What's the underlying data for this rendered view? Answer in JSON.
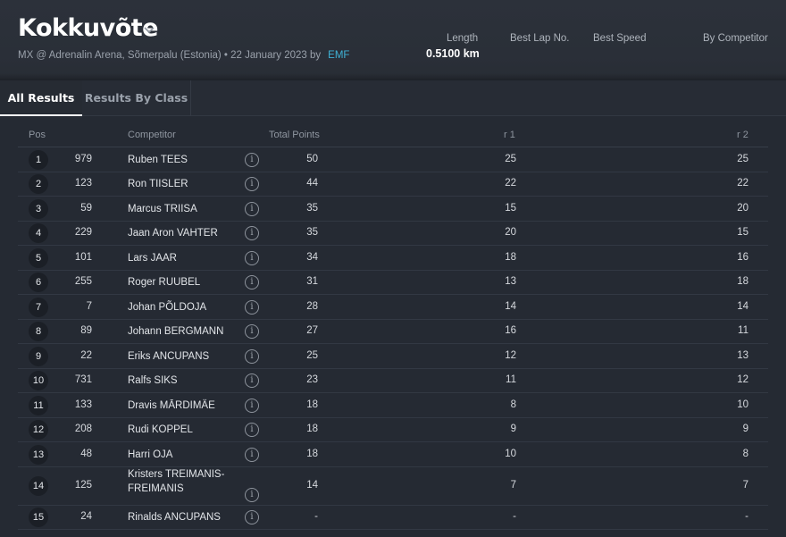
{
  "event": {
    "title": "Kokkuvõte",
    "subtitle": "MX @ Adrenalin Arena, Sõmerpalu (Estonia) • 22 January 2023 by",
    "organizer": "EMF"
  },
  "stats": {
    "length_label": "Length",
    "length_value": "0.5100 km",
    "best_lap_label": "Best Lap No.",
    "best_speed_label": "Best Speed",
    "by_competitor_label": "By Competitor"
  },
  "tabs": [
    {
      "label": "All Results",
      "active": true
    },
    {
      "label": "Results By Class",
      "active": false
    }
  ],
  "table": {
    "headers": {
      "pos": "Pos",
      "competitor": "Competitor",
      "total_points": "Total Points",
      "r1": "r 1",
      "r2": "r 2"
    },
    "rows": [
      {
        "pos": "1",
        "number": "979",
        "name": "Ruben TEES",
        "total": "50",
        "r1": "25",
        "r2": "25"
      },
      {
        "pos": "2",
        "number": "123",
        "name": "Ron TIISLER",
        "total": "44",
        "r1": "22",
        "r2": "22"
      },
      {
        "pos": "3",
        "number": "59",
        "name": "Marcus TRIISA",
        "total": "35",
        "r1": "15",
        "r2": "20"
      },
      {
        "pos": "4",
        "number": "229",
        "name": "Jaan Aron VAHTER",
        "total": "35",
        "r1": "20",
        "r2": "15"
      },
      {
        "pos": "5",
        "number": "101",
        "name": "Lars JAAR",
        "total": "34",
        "r1": "18",
        "r2": "16"
      },
      {
        "pos": "6",
        "number": "255",
        "name": "Roger RUUBEL",
        "total": "31",
        "r1": "13",
        "r2": "18"
      },
      {
        "pos": "7",
        "number": "7",
        "name": "Johan PÕLDOJA",
        "total": "28",
        "r1": "14",
        "r2": "14"
      },
      {
        "pos": "8",
        "number": "89",
        "name": "Johann BERGMANN",
        "total": "27",
        "r1": "16",
        "r2": "11"
      },
      {
        "pos": "9",
        "number": "22",
        "name": "Eriks ANCUPANS",
        "total": "25",
        "r1": "12",
        "r2": "13"
      },
      {
        "pos": "10",
        "number": "731",
        "name": "Ralfs SIKS",
        "total": "23",
        "r1": "11",
        "r2": "12"
      },
      {
        "pos": "11",
        "number": "133",
        "name": "Dravis MĀRDIMÄE",
        "total": "18",
        "r1": "8",
        "r2": "10"
      },
      {
        "pos": "12",
        "number": "208",
        "name": "Rudi KOPPEL",
        "total": "18",
        "r1": "9",
        "r2": "9"
      },
      {
        "pos": "13",
        "number": "48",
        "name": "Harri OJA",
        "total": "18",
        "r1": "10",
        "r2": "8"
      },
      {
        "pos": "14",
        "number": "125",
        "name": "Kristers TREIMANIS-FREIMANIS",
        "total": "14",
        "r1": "7",
        "r2": "7"
      },
      {
        "pos": "15",
        "number": "24",
        "name": "Rinalds ANCUPANS",
        "total": "-",
        "r1": "-",
        "r2": "-"
      }
    ]
  }
}
